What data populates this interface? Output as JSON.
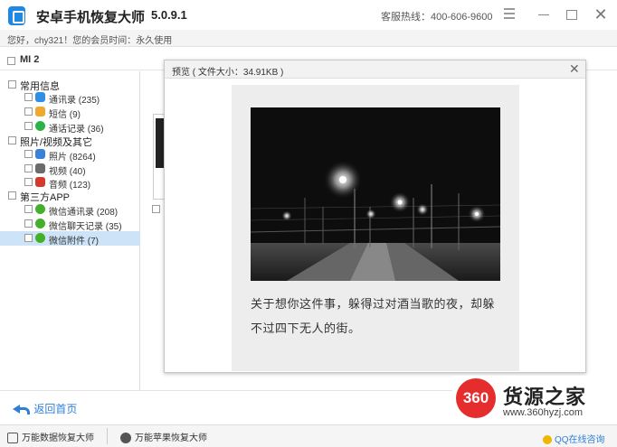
{
  "titlebar": {
    "title": "安卓手机恢复大师",
    "version": "5.0.9.1",
    "hotline": "客服热线：400-606-9600"
  },
  "infobar": {
    "text": "您好，chy321！您的会员时间：永久使用"
  },
  "device": {
    "name": "MI 2"
  },
  "sidebar": {
    "categories": [
      {
        "label": "常用信息",
        "items": [
          {
            "label": "通讯录 (235)",
            "icon": "contacts-icon"
          },
          {
            "label": "短信 (9)",
            "icon": "sms-icon"
          },
          {
            "label": "通话记录 (36)",
            "icon": "phone-icon"
          }
        ]
      },
      {
        "label": "照片/视频及其它",
        "items": [
          {
            "label": "照片 (8264)",
            "icon": "photo-icon"
          },
          {
            "label": "视频 (40)",
            "icon": "video-icon"
          },
          {
            "label": "音频 (123)",
            "icon": "audio-icon"
          }
        ]
      },
      {
        "label": "第三方APP",
        "items": [
          {
            "label": "微信通讯录 (208)",
            "icon": "wechat-icon"
          },
          {
            "label": "微信聊天记录 (35)",
            "icon": "wechat-icon"
          },
          {
            "label": "微信附件 (7)",
            "icon": "wechat-icon",
            "selected": true
          }
        ]
      }
    ]
  },
  "preview": {
    "title": "预览 ( 文件大小：34.91KB )",
    "caption": "关于想你这件事，躲得过对酒当歌的夜，却躲不过四下无人的街。"
  },
  "bottom": {
    "back_label": "返回首页"
  },
  "watermark": {
    "logo": "360",
    "title": "货源之家",
    "url": "www.360hyzj.com"
  },
  "footer": {
    "item1": "万能数据恢复大师",
    "item2": "万能苹果恢复大师",
    "qq": "QQ在线咨询"
  },
  "colors": {
    "accent": "#2f7fd6",
    "selected_row": "#cde3f7",
    "watermark_red": "#e52d2d"
  }
}
